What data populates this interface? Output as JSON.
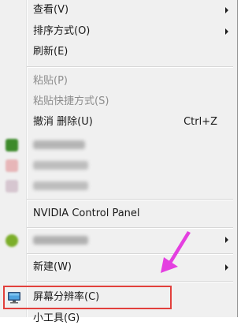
{
  "menu": {
    "view": {
      "label": "查看(V)"
    },
    "sort": {
      "label": "排序方式(O)"
    },
    "refresh": {
      "label": "刷新(E)"
    },
    "paste": {
      "label": "粘贴(P)"
    },
    "paste_shortcut": {
      "label": "粘贴快捷方式(S)"
    },
    "undo_delete": {
      "label": "撤消 删除(U)",
      "shortcut": "Ctrl+Z"
    },
    "nvidia": {
      "label": "NVIDIA Control Panel"
    },
    "new": {
      "label": "新建(W)"
    },
    "screen_resolution": {
      "label": "屏幕分辨率(C)"
    },
    "gadgets": {
      "label": "小工具(G)"
    }
  },
  "colors": {
    "highlight_border": "#e2403c",
    "annotation_arrow": "#e43fe0"
  }
}
